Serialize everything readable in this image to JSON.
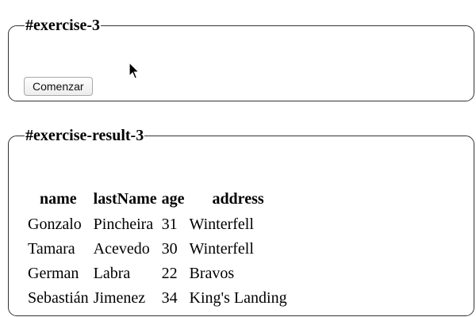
{
  "exercise": {
    "legend": "#exercise-3",
    "button_label": "Comenzar"
  },
  "result": {
    "legend": "#exercise-result-3",
    "columns": [
      "name",
      "lastName",
      "age",
      "address"
    ],
    "rows": [
      [
        "Gonzalo",
        "Pincheira",
        "31",
        "Winterfell"
      ],
      [
        "Tamara",
        "Acevedo",
        "30",
        "Winterfell"
      ],
      [
        "German",
        "Labra",
        "22",
        "Bravos"
      ],
      [
        "Sebastián",
        "Jimenez",
        "34",
        "King's Landing"
      ]
    ]
  },
  "cursor_icon": "arrow-pointer-icon"
}
